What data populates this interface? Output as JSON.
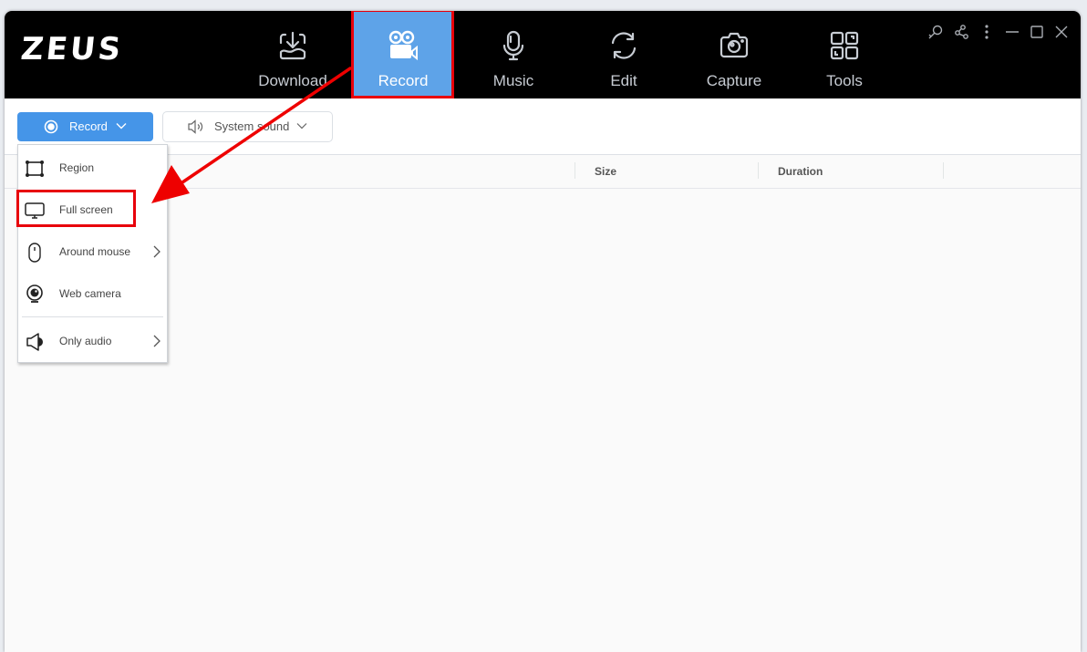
{
  "app": {
    "logo": "ZEUS"
  },
  "nav": {
    "items": [
      {
        "label": "Download",
        "icon": "download-icon",
        "active": false
      },
      {
        "label": "Record",
        "icon": "video-camera-icon",
        "active": true
      },
      {
        "label": "Music",
        "icon": "microphone-icon",
        "active": false
      },
      {
        "label": "Edit",
        "icon": "convert-icon",
        "active": false
      },
      {
        "label": "Capture",
        "icon": "camera-icon",
        "active": false
      },
      {
        "label": "Tools",
        "icon": "tools-grid-icon",
        "active": false
      }
    ]
  },
  "window_controls": [
    "key-icon",
    "share-icon",
    "more-icon",
    "minimize-icon",
    "maximize-icon",
    "close-icon"
  ],
  "toolbar": {
    "record_label": "Record",
    "sound_label": "System sound"
  },
  "table": {
    "columns": [
      "Size",
      "Duration"
    ]
  },
  "record_menu": {
    "items": [
      {
        "label": "Region",
        "icon": "region-icon",
        "submenu": false
      },
      {
        "label": "Full screen",
        "icon": "monitor-icon",
        "submenu": false,
        "highlighted": true
      },
      {
        "label": "Around mouse",
        "icon": "mouse-icon",
        "submenu": true
      },
      {
        "label": "Web camera",
        "icon": "webcam-icon",
        "submenu": false
      },
      {
        "label": "Only audio",
        "icon": "speaker-icon",
        "submenu": true
      }
    ]
  },
  "colors": {
    "accent": "#4595e8",
    "nav_active": "#5ea3e8",
    "annotation": "#e8000b",
    "topbar": "#000000"
  }
}
